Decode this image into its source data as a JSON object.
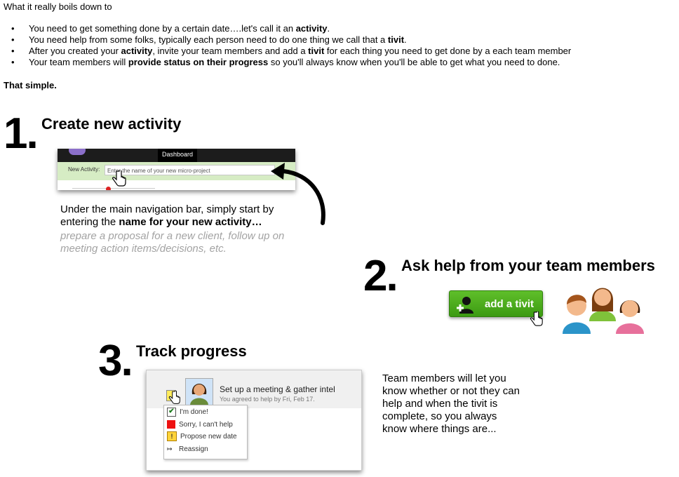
{
  "intro": {
    "title": "What it really boils down to",
    "bullets": [
      [
        {
          "t": "You need to get something done by a certain date….let's call it an "
        },
        {
          "t": "activity",
          "b": true
        },
        {
          "t": "."
        }
      ],
      [
        {
          "t": "You need help from some folks, typically each person need to do one thing we call that a "
        },
        {
          "t": "tivit",
          "b": true
        },
        {
          "t": "."
        }
      ],
      [
        {
          "t": "After you created your "
        },
        {
          "t": "activity",
          "b": true
        },
        {
          "t": ", invite your team members and add a "
        },
        {
          "t": "tivit",
          "b": true
        },
        {
          "t": " for each thing you need to get done by a each team member"
        }
      ],
      [
        {
          "t": "Your team members will "
        },
        {
          "t": "provide status on their progress",
          "b": true
        },
        {
          "t": " so you'll always know when you'll be able to get what you need to done."
        }
      ]
    ],
    "closing": "That simple."
  },
  "step1": {
    "number": "1.",
    "title": "Create new activity",
    "shot": {
      "nav_tab": "Dashboard",
      "field_label": "New Activity:",
      "field_placeholder": "Enter the name of your new micro-project"
    },
    "desc_plain": "Under the main navigation bar, simply start by entering the ",
    "desc_bold": "name for your new activity…",
    "examples": "prepare a proposal for a new client, follow up on meeting action items/decisions, etc."
  },
  "step2": {
    "number": "2.",
    "title": "Ask help from your team members",
    "button_label": "add a tivit"
  },
  "step3": {
    "number": "3.",
    "title": "Track progress",
    "shot": {
      "task_title": "Set up a meeting & gather intel",
      "task_sub": "You agreed to help by Fri, Feb 17.",
      "menu": [
        "I'm done!",
        "Sorry, I can't help",
        "Propose new date",
        "Reassign"
      ]
    },
    "desc": "Team members will let you know whether or not they can help and when the tivit is complete, so you always know where things are..."
  },
  "colors": {
    "accent_green": "#4caf1e",
    "example_gray": "#a3a3a3",
    "toolbar_green": "#d6ecc4"
  }
}
